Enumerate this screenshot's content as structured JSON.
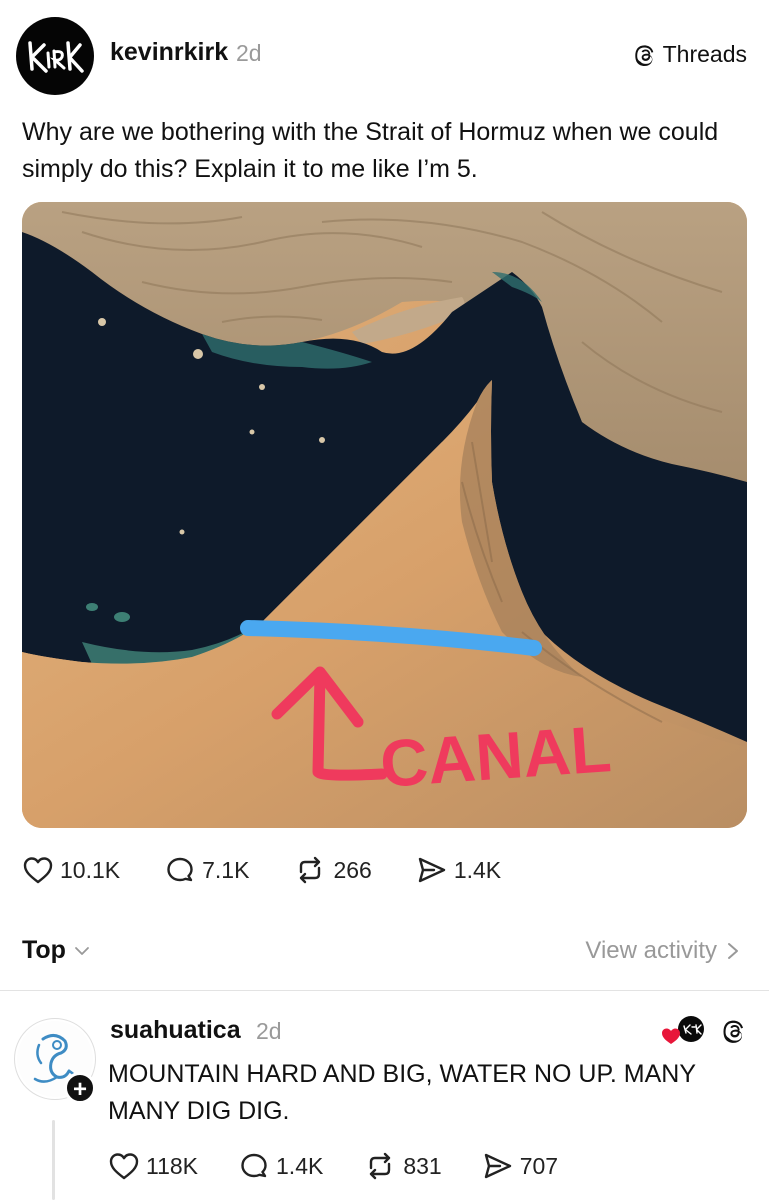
{
  "post": {
    "username": "kevinrkirk",
    "time": "2d",
    "badge_label": "Threads",
    "text": "Why are we bothering with the Strait of Hormuz when we could simply do this? Explain it to me like I’m 5.",
    "map_annotation": "CANAL",
    "stats": {
      "likes": "10.1K",
      "comments": "7.1K",
      "reposts": "266",
      "shares": "1.4K"
    }
  },
  "replies_bar": {
    "sort_label": "Top",
    "view_activity": "View activity"
  },
  "reply": {
    "username": "suahuatica",
    "time": "2d",
    "text": "MOUNTAIN HARD AND BIG, WATER NO UP. MANY MANY DIG DIG.",
    "stats": {
      "likes": "118K",
      "comments": "1.4K",
      "reposts": "831",
      "shares": "707"
    }
  },
  "icons": {
    "like": "heart-icon",
    "comment": "comment-bubble-icon",
    "repost": "repost-icon",
    "share": "send-icon",
    "threads": "threads-logo-icon"
  },
  "colors": {
    "canal_line": "#4aa8f0",
    "annotation": "#ef3a5d",
    "secondary_text": "#9a9a9a"
  }
}
